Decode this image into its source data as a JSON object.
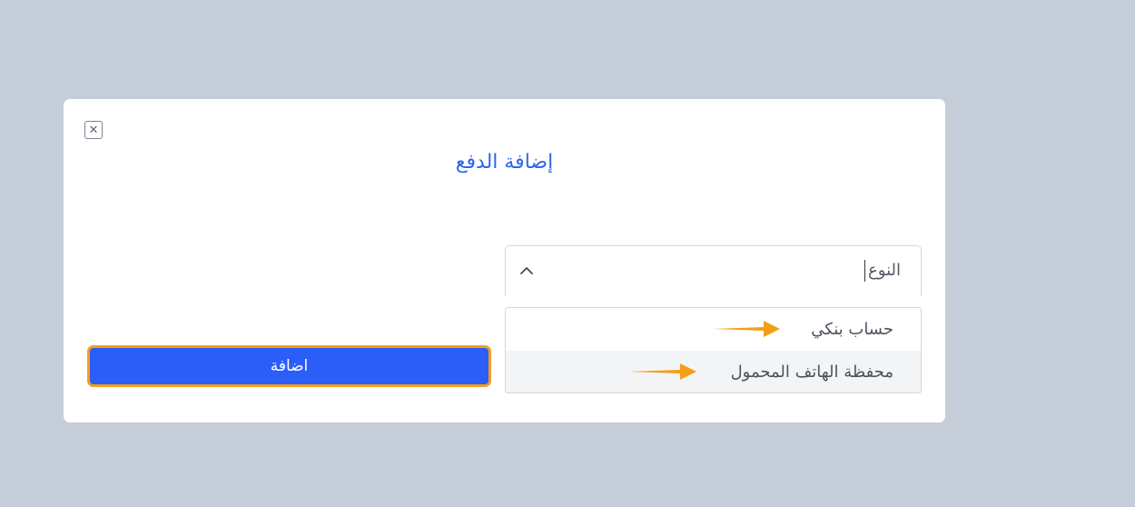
{
  "dialog": {
    "title": "إضافة الدفع",
    "close_icon": "close-icon"
  },
  "type_select": {
    "value": "النوع",
    "chevron_icon": "chevron-up-icon",
    "expanded": true,
    "options": [
      {
        "label": "حساب بنكي",
        "highlighted": false
      },
      {
        "label": "محفظة الهاتف المحمول",
        "highlighted": true
      }
    ]
  },
  "add_button": {
    "label": "اضافة"
  },
  "colors": {
    "backdrop": "#c4cdd8",
    "title": "#2d67e6",
    "primary_button": "#2b5ef9",
    "annotation": "#f59e17"
  }
}
